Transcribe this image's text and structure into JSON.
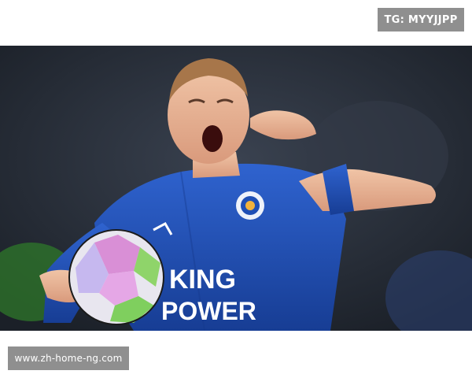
{
  "header": {
    "tag_text": "TG: MYYJJPP"
  },
  "photo": {
    "subject": "footballer-celebrating",
    "shirt_sponsor_line1": "KING",
    "shirt_sponsor_line2": "POWER",
    "colors": {
      "shirt": "#1f4fb5",
      "background": "#232a33",
      "skin": "#e9b89a"
    }
  },
  "footer": {
    "url_text": "www.zh-home-ng.com"
  }
}
